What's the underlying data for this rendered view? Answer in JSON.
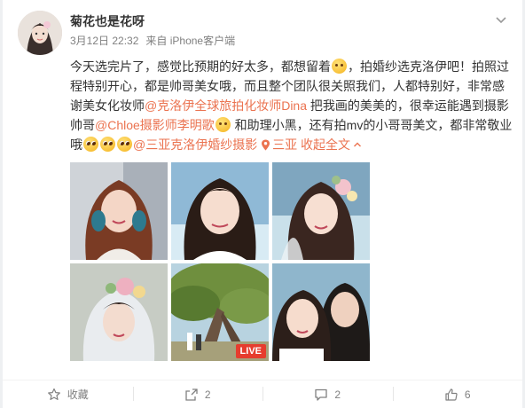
{
  "post": {
    "username": "菊花也是花呀",
    "time": "3月12日 22:32",
    "source": "来自 iPhone客户端",
    "text": {
      "p1": "今天选完片了，感觉比预期的好太多，都想留着",
      "p2": "，拍婚纱选克洛伊吧！拍照过程特别开心，都是帅哥美女哦，而且整个团队很关照我们，人都特别好，非常感谢美女化妆师",
      "mention1": "@克洛伊全球旅拍化妆师Dina",
      "p3": " 把我画的美美的，很幸运能遇到摄影帅哥",
      "mention2": "@Chloe摄影师李明歌",
      "p4": " 和助理小黑，还有拍mv的小哥哥美文，都非常敬业哦",
      "mention3": "@三亚克洛伊婚纱摄影",
      "location": "三亚",
      "expand": "收起全文"
    },
    "photos": [
      {
        "name": "photo-1",
        "live": ""
      },
      {
        "name": "photo-2",
        "live": ""
      },
      {
        "name": "photo-3",
        "live": ""
      },
      {
        "name": "photo-4",
        "live": ""
      },
      {
        "name": "photo-5",
        "live": "LIVE"
      },
      {
        "name": "photo-6",
        "live": ""
      }
    ]
  },
  "actions": {
    "favorite_label": "收藏",
    "repost_count": "2",
    "comment_count": "2",
    "like_count": "6"
  },
  "colors": {
    "link": "#eb7350",
    "muted": "#808080",
    "text": "#333333",
    "live_badge": "#e63c2e"
  }
}
